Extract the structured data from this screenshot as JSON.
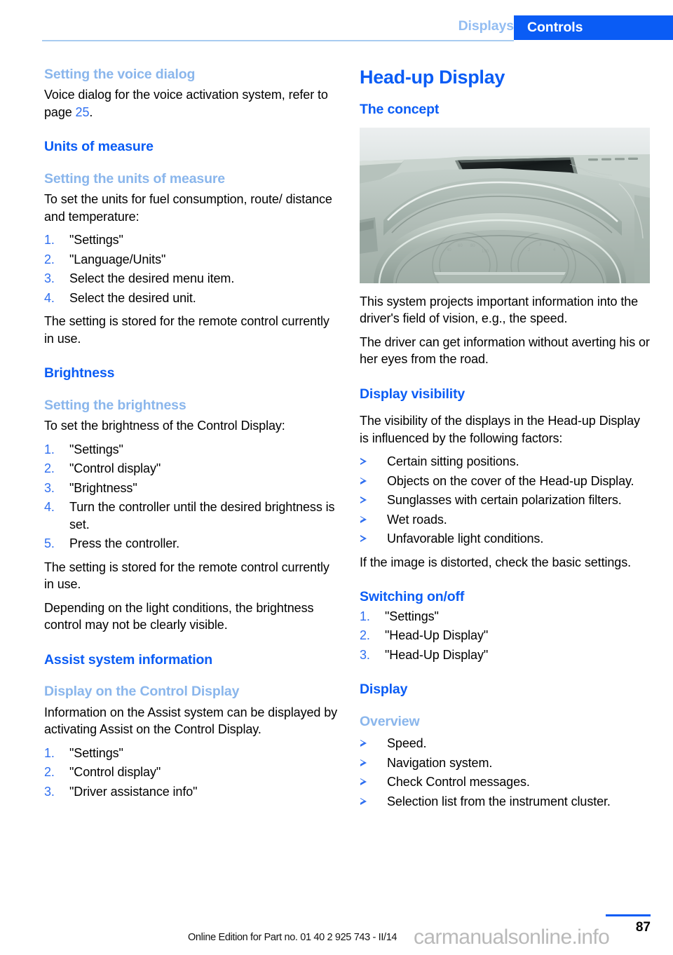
{
  "header": {
    "tab_inactive": "Displays",
    "tab_active": "Controls",
    "accent_color": "#0a5cf5",
    "muted_accent_color": "#8ab6ec"
  },
  "left_column": {
    "voice_dialog": {
      "heading": "Setting the voice dialog",
      "body_before": "Voice dialog for the voice activation system, refer to page ",
      "page_ref": "25",
      "body_after": "."
    },
    "units_of_measure": {
      "heading": "Units of measure",
      "sub_heading": "Setting the units of measure",
      "intro": "To set the units for fuel consumption, route/ distance and temperature:",
      "steps": [
        "\"Settings\"",
        "\"Language/Units\"",
        "Select the desired menu item.",
        "Select the desired unit."
      ],
      "outro": "The setting is stored for the remote control currently in use."
    },
    "brightness": {
      "heading": "Brightness",
      "sub_heading": "Setting the brightness",
      "intro": "To set the brightness of the Control Display:",
      "steps": [
        "\"Settings\"",
        "\"Control display\"",
        "\"Brightness\"",
        "Turn the controller until the desired brightness is set.",
        "Press the controller."
      ],
      "outro_1": "The setting is stored for the remote control currently in use.",
      "outro_2": "Depending on the light conditions, the brightness control may not be clearly visible."
    },
    "assist_system": {
      "heading": "Assist system information",
      "sub_heading": "Display on the Control Display",
      "intro": "Information on the Assist system can be displayed by activating Assist on the Control Display.",
      "steps": [
        "\"Settings\"",
        "\"Control display\"",
        "\"Driver assistance info\""
      ]
    }
  },
  "right_column": {
    "title": "Head-up Display",
    "concept": {
      "heading": "The concept",
      "figure_alt": "car-dashboard-head-up-display-illustration",
      "paragraph_1": "This system projects important information into the driver's field of vision, e.g., the speed.",
      "paragraph_2": "The driver can get information without averting his or her eyes from the road."
    },
    "display_visibility": {
      "heading": "Display visibility",
      "intro": "The visibility of the displays in the Head-up Display is influenced by the following factors:",
      "bullets": [
        "Certain sitting positions.",
        "Objects on the cover of the Head-up Display.",
        "Sunglasses with certain polarization filters.",
        "Wet roads.",
        "Unfavorable light conditions."
      ],
      "outro": "If the image is distorted, check the basic settings."
    },
    "switching_on_off": {
      "heading": "Switching on/off",
      "steps": [
        "\"Settings\"",
        "\"Head-Up Display\"",
        "\"Head-Up Display\""
      ]
    },
    "display": {
      "heading": "Display",
      "sub_heading": "Overview",
      "bullets": [
        "Speed.",
        "Navigation system.",
        "Check Control messages.",
        "Selection list from the instrument cluster."
      ]
    }
  },
  "footer": {
    "edition_note": "Online Edition for Part no. 01 40 2 925 743 - II/14",
    "page_number": "87",
    "watermark": "carmanualsonline.info"
  }
}
